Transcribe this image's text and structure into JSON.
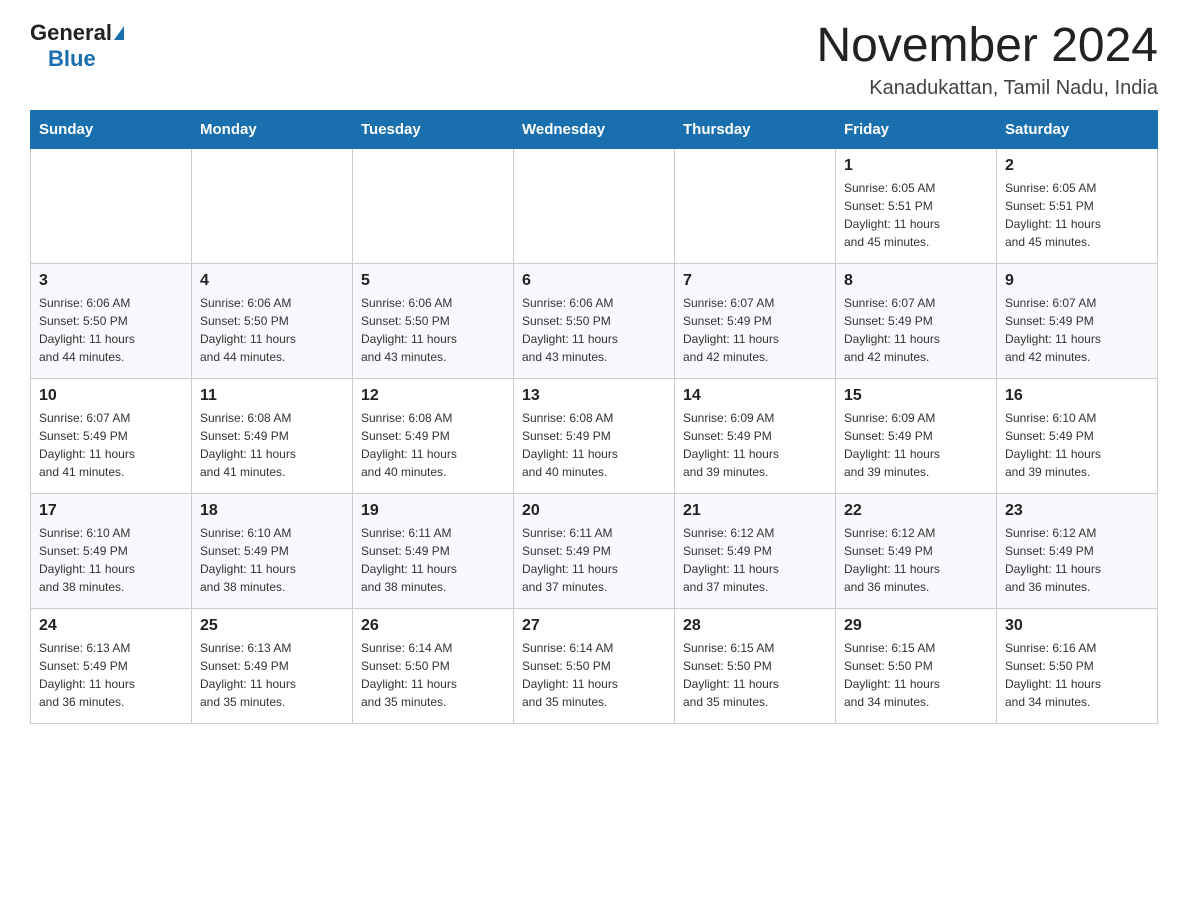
{
  "logo": {
    "general": "General",
    "blue": "Blue"
  },
  "title": "November 2024",
  "location": "Kanadukattan, Tamil Nadu, India",
  "weekdays": [
    "Sunday",
    "Monday",
    "Tuesday",
    "Wednesday",
    "Thursday",
    "Friday",
    "Saturday"
  ],
  "weeks": [
    [
      {
        "day": "",
        "info": ""
      },
      {
        "day": "",
        "info": ""
      },
      {
        "day": "",
        "info": ""
      },
      {
        "day": "",
        "info": ""
      },
      {
        "day": "",
        "info": ""
      },
      {
        "day": "1",
        "info": "Sunrise: 6:05 AM\nSunset: 5:51 PM\nDaylight: 11 hours\nand 45 minutes."
      },
      {
        "day": "2",
        "info": "Sunrise: 6:05 AM\nSunset: 5:51 PM\nDaylight: 11 hours\nand 45 minutes."
      }
    ],
    [
      {
        "day": "3",
        "info": "Sunrise: 6:06 AM\nSunset: 5:50 PM\nDaylight: 11 hours\nand 44 minutes."
      },
      {
        "day": "4",
        "info": "Sunrise: 6:06 AM\nSunset: 5:50 PM\nDaylight: 11 hours\nand 44 minutes."
      },
      {
        "day": "5",
        "info": "Sunrise: 6:06 AM\nSunset: 5:50 PM\nDaylight: 11 hours\nand 43 minutes."
      },
      {
        "day": "6",
        "info": "Sunrise: 6:06 AM\nSunset: 5:50 PM\nDaylight: 11 hours\nand 43 minutes."
      },
      {
        "day": "7",
        "info": "Sunrise: 6:07 AM\nSunset: 5:49 PM\nDaylight: 11 hours\nand 42 minutes."
      },
      {
        "day": "8",
        "info": "Sunrise: 6:07 AM\nSunset: 5:49 PM\nDaylight: 11 hours\nand 42 minutes."
      },
      {
        "day": "9",
        "info": "Sunrise: 6:07 AM\nSunset: 5:49 PM\nDaylight: 11 hours\nand 42 minutes."
      }
    ],
    [
      {
        "day": "10",
        "info": "Sunrise: 6:07 AM\nSunset: 5:49 PM\nDaylight: 11 hours\nand 41 minutes."
      },
      {
        "day": "11",
        "info": "Sunrise: 6:08 AM\nSunset: 5:49 PM\nDaylight: 11 hours\nand 41 minutes."
      },
      {
        "day": "12",
        "info": "Sunrise: 6:08 AM\nSunset: 5:49 PM\nDaylight: 11 hours\nand 40 minutes."
      },
      {
        "day": "13",
        "info": "Sunrise: 6:08 AM\nSunset: 5:49 PM\nDaylight: 11 hours\nand 40 minutes."
      },
      {
        "day": "14",
        "info": "Sunrise: 6:09 AM\nSunset: 5:49 PM\nDaylight: 11 hours\nand 39 minutes."
      },
      {
        "day": "15",
        "info": "Sunrise: 6:09 AM\nSunset: 5:49 PM\nDaylight: 11 hours\nand 39 minutes."
      },
      {
        "day": "16",
        "info": "Sunrise: 6:10 AM\nSunset: 5:49 PM\nDaylight: 11 hours\nand 39 minutes."
      }
    ],
    [
      {
        "day": "17",
        "info": "Sunrise: 6:10 AM\nSunset: 5:49 PM\nDaylight: 11 hours\nand 38 minutes."
      },
      {
        "day": "18",
        "info": "Sunrise: 6:10 AM\nSunset: 5:49 PM\nDaylight: 11 hours\nand 38 minutes."
      },
      {
        "day": "19",
        "info": "Sunrise: 6:11 AM\nSunset: 5:49 PM\nDaylight: 11 hours\nand 38 minutes."
      },
      {
        "day": "20",
        "info": "Sunrise: 6:11 AM\nSunset: 5:49 PM\nDaylight: 11 hours\nand 37 minutes."
      },
      {
        "day": "21",
        "info": "Sunrise: 6:12 AM\nSunset: 5:49 PM\nDaylight: 11 hours\nand 37 minutes."
      },
      {
        "day": "22",
        "info": "Sunrise: 6:12 AM\nSunset: 5:49 PM\nDaylight: 11 hours\nand 36 minutes."
      },
      {
        "day": "23",
        "info": "Sunrise: 6:12 AM\nSunset: 5:49 PM\nDaylight: 11 hours\nand 36 minutes."
      }
    ],
    [
      {
        "day": "24",
        "info": "Sunrise: 6:13 AM\nSunset: 5:49 PM\nDaylight: 11 hours\nand 36 minutes."
      },
      {
        "day": "25",
        "info": "Sunrise: 6:13 AM\nSunset: 5:49 PM\nDaylight: 11 hours\nand 35 minutes."
      },
      {
        "day": "26",
        "info": "Sunrise: 6:14 AM\nSunset: 5:50 PM\nDaylight: 11 hours\nand 35 minutes."
      },
      {
        "day": "27",
        "info": "Sunrise: 6:14 AM\nSunset: 5:50 PM\nDaylight: 11 hours\nand 35 minutes."
      },
      {
        "day": "28",
        "info": "Sunrise: 6:15 AM\nSunset: 5:50 PM\nDaylight: 11 hours\nand 35 minutes."
      },
      {
        "day": "29",
        "info": "Sunrise: 6:15 AM\nSunset: 5:50 PM\nDaylight: 11 hours\nand 34 minutes."
      },
      {
        "day": "30",
        "info": "Sunrise: 6:16 AM\nSunset: 5:50 PM\nDaylight: 11 hours\nand 34 minutes."
      }
    ]
  ]
}
